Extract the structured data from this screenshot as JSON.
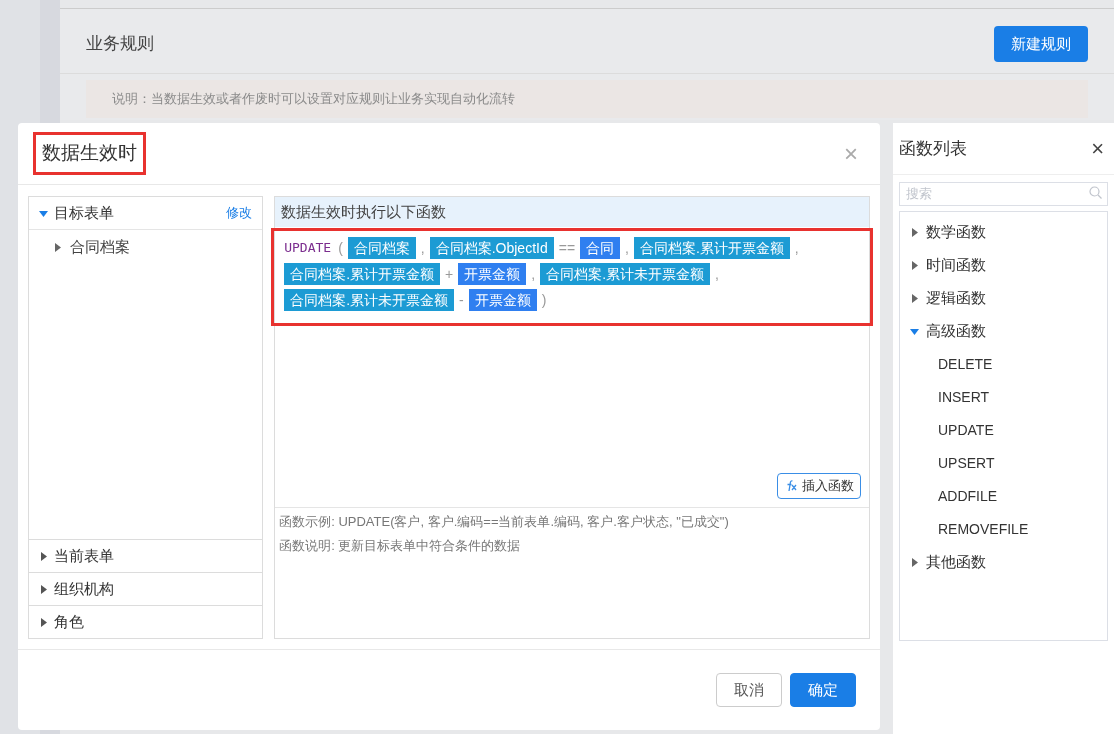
{
  "page": {
    "title": "业务规则",
    "new_button": "新建规则",
    "notice": "说明：当数据生效或者作废时可以设置对应规则让业务实现自动化流转"
  },
  "dialog": {
    "title": "数据生效时",
    "title_highlighted": true,
    "close": "×",
    "tree": [
      {
        "label": "目标表单",
        "expanded": true,
        "action": "修改",
        "children": [
          {
            "label": "合同档案",
            "expanded": false
          }
        ]
      },
      {
        "label": "当前表单",
        "expanded": false
      },
      {
        "label": "组织机构",
        "expanded": false
      },
      {
        "label": "角色",
        "expanded": false
      }
    ],
    "editor": {
      "header": "数据生效时执行以下函数",
      "highlighted": true,
      "tokens": [
        {
          "kind": "function",
          "text": "UPDATE"
        },
        {
          "kind": "punct",
          "text": "("
        },
        {
          "kind": "field",
          "text": "合同档案"
        },
        {
          "kind": "punct",
          "text": ","
        },
        {
          "kind": "field",
          "text": "合同档案.ObjectId"
        },
        {
          "kind": "punct",
          "text": "=="
        },
        {
          "kind": "variable",
          "text": "合同"
        },
        {
          "kind": "punct",
          "text": ","
        },
        {
          "kind": "field",
          "text": "合同档案.累计开票金额"
        },
        {
          "kind": "punct",
          "text": ","
        },
        {
          "kind": "field",
          "text": "合同档案.累计开票金额"
        },
        {
          "kind": "punct",
          "text": "+"
        },
        {
          "kind": "variable",
          "text": "开票金额"
        },
        {
          "kind": "punct",
          "text": ","
        },
        {
          "kind": "field",
          "text": "合同档案.累计未开票金额"
        },
        {
          "kind": "punct",
          "text": ","
        },
        {
          "kind": "field",
          "text": "合同档案.累计未开票金额"
        },
        {
          "kind": "punct",
          "text": "-"
        },
        {
          "kind": "variable",
          "text": "开票金额"
        },
        {
          "kind": "punct",
          "text": ")"
        }
      ],
      "insert_button": "插入函数",
      "example": "函数示例: UPDATE(客户, 客户.编码==当前表单.编码, 客户.客户状态, \"已成交\")",
      "description": "函数说明: 更新目标表单中符合条件的数据"
    },
    "buttons": [
      {
        "label": "取消",
        "primary": false
      },
      {
        "label": "确定",
        "primary": true
      }
    ]
  },
  "function_list": {
    "title": "函数列表",
    "close": "×",
    "search": {
      "placeholder": "搜索"
    },
    "groups": [
      {
        "label": "数学函数",
        "expanded": false
      },
      {
        "label": "时间函数",
        "expanded": false
      },
      {
        "label": "逻辑函数",
        "expanded": false
      },
      {
        "label": "高级函数",
        "expanded": true,
        "children": [
          "DELETE",
          "INSERT",
          "UPDATE",
          "UPSERT",
          "ADDFILE",
          "REMOVEFILE"
        ]
      },
      {
        "label": "其他函数",
        "expanded": false
      }
    ]
  }
}
